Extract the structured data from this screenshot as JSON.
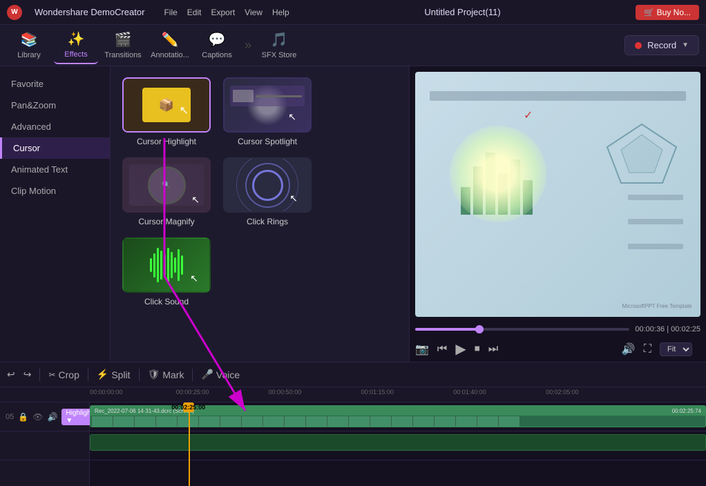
{
  "app": {
    "logo": "W",
    "name": "Wondershare DemoCreator",
    "project_title": "Untitled Project(11)",
    "buy_label": "🛒 Buy No..."
  },
  "menu": {
    "items": [
      "File",
      "Edit",
      "Export",
      "View",
      "Help"
    ]
  },
  "toolbar": {
    "items": [
      {
        "id": "library",
        "label": "Library",
        "icon": "📚"
      },
      {
        "id": "effects",
        "label": "Effects",
        "icon": "✨",
        "active": true
      },
      {
        "id": "transitions",
        "label": "Transitions",
        "icon": "🎬"
      },
      {
        "id": "annotations",
        "label": "Annotatio...",
        "icon": "✏️"
      },
      {
        "id": "captions",
        "label": "Captions",
        "icon": "💬"
      },
      {
        "id": "sfx",
        "label": "SFX Store",
        "icon": "🎵"
      }
    ],
    "more_icon": "»",
    "record_label": "Record",
    "record_dropdown": "▼"
  },
  "sidebar": {
    "items": [
      {
        "id": "favorite",
        "label": "Favorite"
      },
      {
        "id": "panzoom",
        "label": "Pan&Zoom"
      },
      {
        "id": "advanced",
        "label": "Advanced"
      },
      {
        "id": "cursor",
        "label": "Cursor",
        "active": true
      },
      {
        "id": "animatedtext",
        "label": "Animated Text"
      },
      {
        "id": "clipmotion",
        "label": "Clip Motion"
      }
    ]
  },
  "effects": {
    "items": [
      {
        "id": "cursor-highlight",
        "label": "Cursor Highlight",
        "selected": true
      },
      {
        "id": "cursor-spotlight",
        "label": "Cursor Spotlight"
      },
      {
        "id": "cursor-magnify",
        "label": "Cursor Magnify"
      },
      {
        "id": "click-rings",
        "label": "Click Rings"
      },
      {
        "id": "click-sound",
        "label": "Click Sound"
      }
    ]
  },
  "preview": {
    "time_current": "00:00:36",
    "time_total": "00:02:25",
    "fit_label": "Fit",
    "progress_percent": 30
  },
  "timeline": {
    "toolbar": {
      "undo_label": "↩",
      "redo_label": "↪",
      "crop_label": "Crop",
      "split_label": "Split",
      "mark_label": "Mark",
      "voice_label": "Voice"
    },
    "playhead_time": "00:02:25:00",
    "ruler_marks": [
      "00:00:00:00",
      "00:00:25:00",
      "00:00:50:00",
      "00:01:15:00",
      "00:01:40:00",
      "00:02:05:00"
    ],
    "track": {
      "number": "05",
      "name": "Highlight",
      "clip_title": "Rec_2022-07-06 14·31-43.dcrc (Screen)",
      "clip_end": "00:02:25:74"
    }
  },
  "icons": {
    "lock": "🔒",
    "eye": "👁",
    "audio": "🔊",
    "scissors": "✂",
    "marker": "📍",
    "mic": "🎤",
    "camera": "📷",
    "rewind": "⏮",
    "play": "▶",
    "stop": "⏹",
    "forward": "⏭",
    "volume": "🔊",
    "fullscreen": "⛶",
    "chevron_down": "▼",
    "dropdown": "▼"
  }
}
